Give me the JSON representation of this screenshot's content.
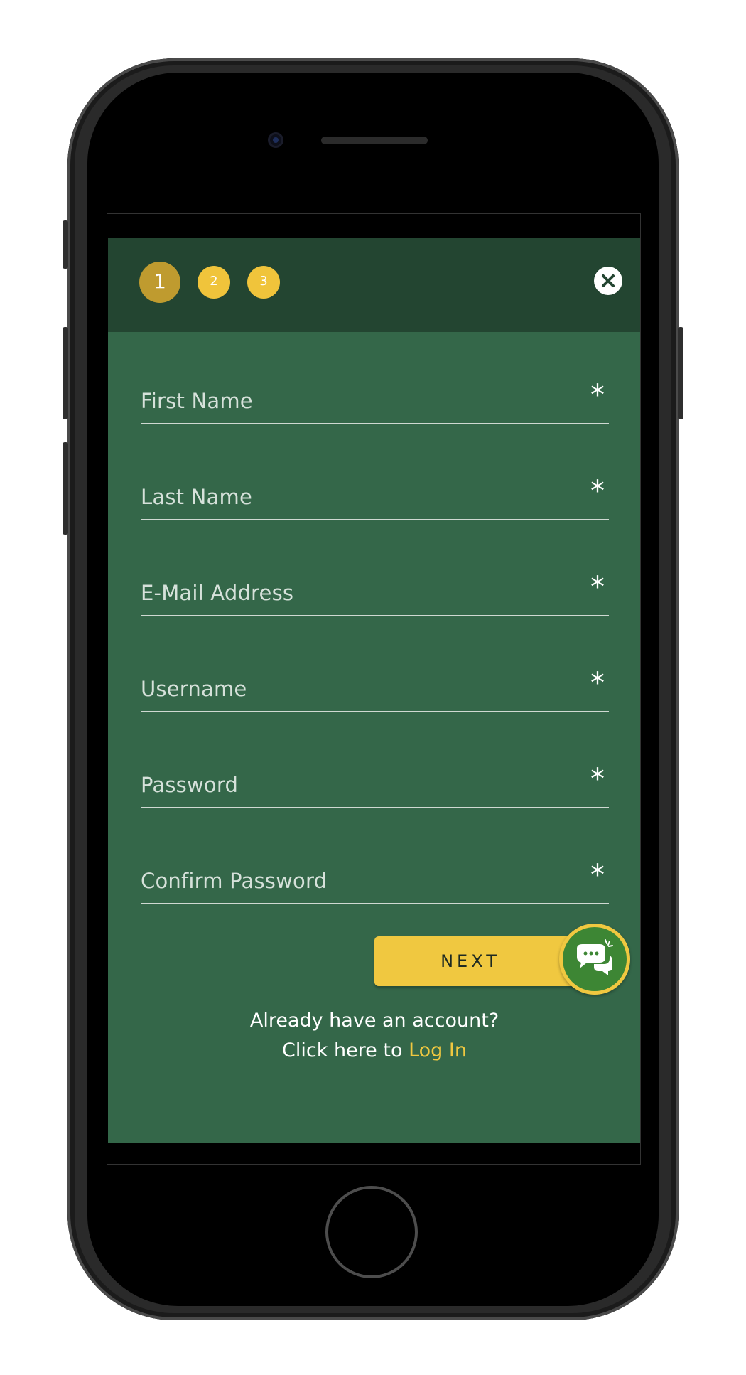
{
  "stepper": {
    "steps": [
      "1",
      "2",
      "3"
    ],
    "active_step": 1
  },
  "form": {
    "fields": [
      {
        "label": "First Name",
        "required_marker": "*"
      },
      {
        "label": "Last Name",
        "required_marker": "*"
      },
      {
        "label": "E-Mail Address",
        "required_marker": "*"
      },
      {
        "label": "Username",
        "required_marker": "*"
      },
      {
        "label": "Password",
        "required_marker": "*"
      },
      {
        "label": "Confirm Password",
        "required_marker": "*"
      }
    ],
    "next_label": "NEXT"
  },
  "login_prompt": {
    "line1": "Already have an account?",
    "line2_prefix": "Click here to ",
    "link_label": "Log In"
  },
  "icons": {
    "close": "close-icon",
    "chat": "chat-bubbles-icon"
  },
  "colors": {
    "background": "#346749",
    "header": "#234531",
    "accent": "#f0c840",
    "active_step": "#bf9b2f",
    "chat": "#3d8634"
  }
}
